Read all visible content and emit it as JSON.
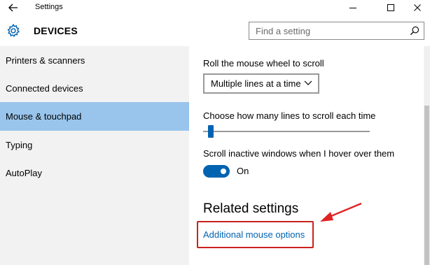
{
  "titlebar": {
    "app_title": "Settings",
    "back_icon": "back-arrow-icon",
    "minimize_icon": "minimize-icon",
    "maximize_icon": "maximize-icon",
    "close_icon": "close-icon"
  },
  "header": {
    "section_title": "DEVICES",
    "section_icon": "gear-icon",
    "search": {
      "placeholder": "Find a setting",
      "value": "",
      "icon": "search-icon"
    }
  },
  "sidebar": {
    "items": [
      {
        "label": "Printers & scanners",
        "selected": false
      },
      {
        "label": "Connected devices",
        "selected": false
      },
      {
        "label": "Mouse & touchpad",
        "selected": true
      },
      {
        "label": "Typing",
        "selected": false
      },
      {
        "label": "AutoPlay",
        "selected": false
      }
    ]
  },
  "main": {
    "wheel_label": "Roll the mouse wheel to scroll",
    "wheel_value": "Multiple lines at a time",
    "lines_label": "Choose how many lines to scroll each time",
    "lines_slider_level": 0.03,
    "inactive_label": "Scroll inactive windows when I hover over them",
    "inactive_toggle_state": "On",
    "related_heading": "Related settings",
    "additional_link": "Additional mouse options"
  },
  "colors": {
    "accent": "#0063b1",
    "selected_nav": "#99c5ec",
    "sidebar_bg": "#f2f2f2",
    "annotation_red": "#c9211e"
  }
}
